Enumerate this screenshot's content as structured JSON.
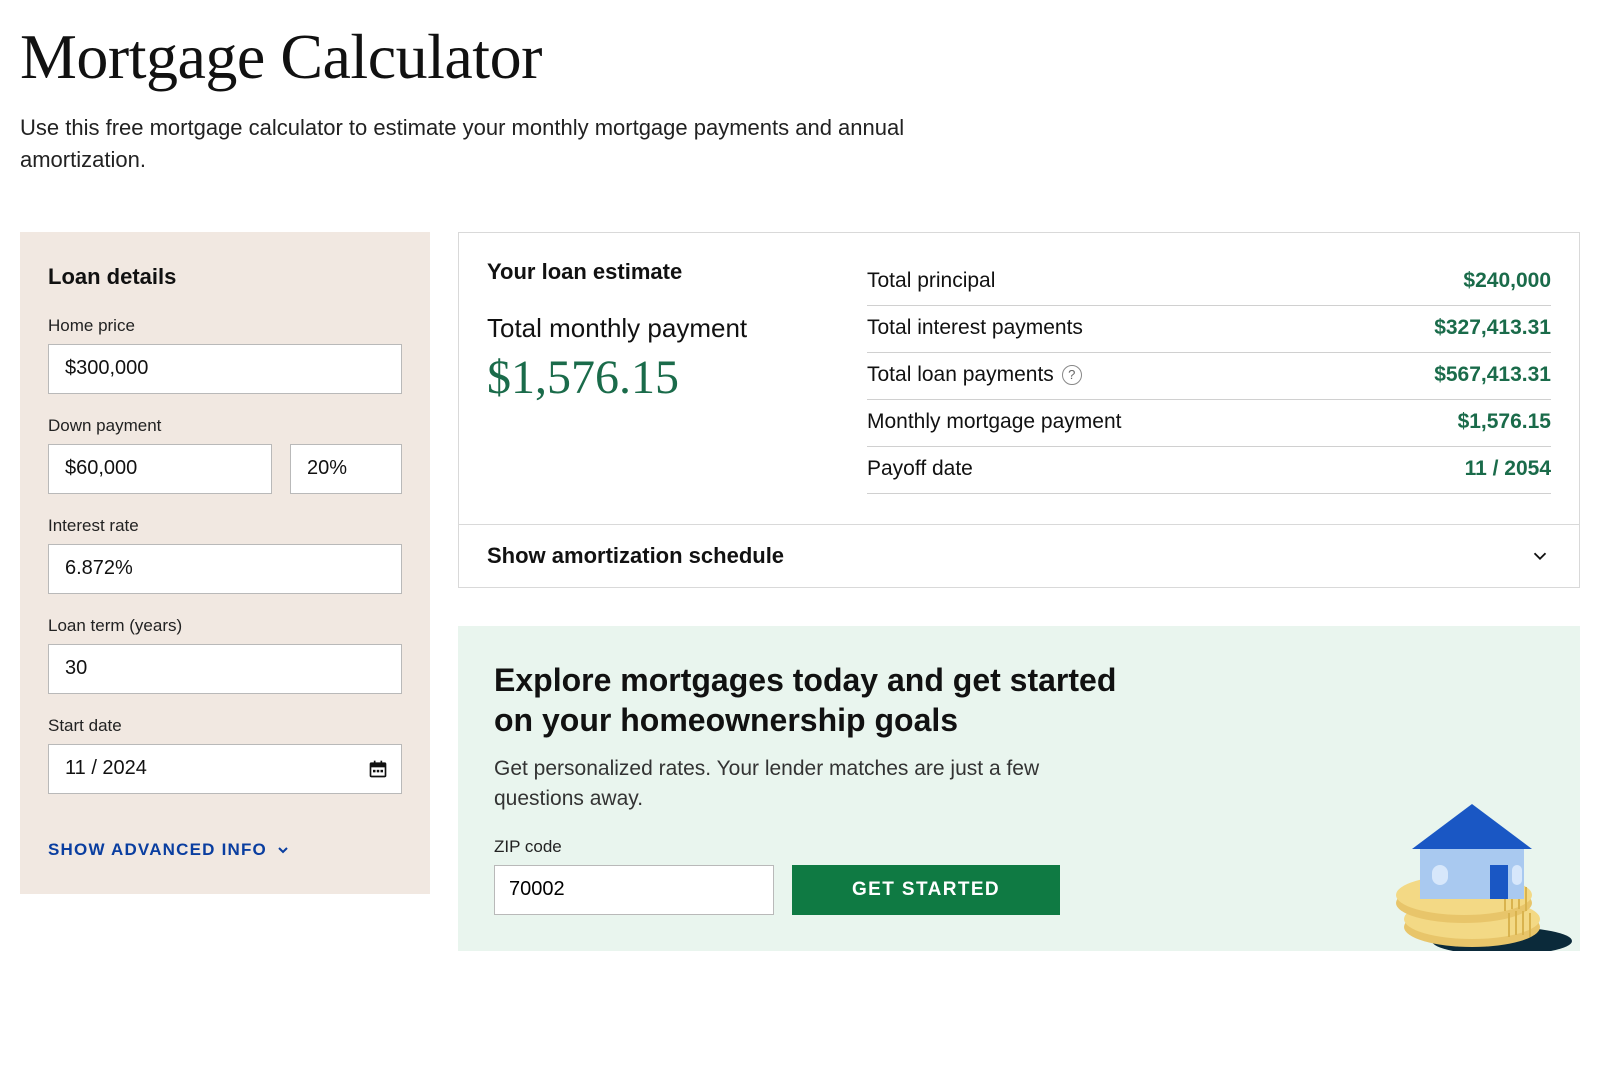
{
  "page": {
    "title": "Mortgage Calculator",
    "subtitle": "Use this free mortgage calculator to estimate your monthly mortgage payments and annual amortization."
  },
  "loan_details": {
    "heading": "Loan details",
    "home_price": {
      "label": "Home price",
      "value": "$300,000"
    },
    "down_payment": {
      "label": "Down payment",
      "amount": "$60,000",
      "percent": "20%"
    },
    "interest_rate": {
      "label": "Interest rate",
      "value": "6.872%"
    },
    "loan_term": {
      "label": "Loan term (years)",
      "value": "30"
    },
    "start_date": {
      "label": "Start date",
      "value": "11 / 2024"
    },
    "advanced_toggle": "SHOW ADVANCED INFO"
  },
  "estimate": {
    "heading": "Your loan estimate",
    "total_monthly_payment": {
      "label": "Total monthly payment",
      "value": "$1,576.15"
    },
    "rows": {
      "total_principal": {
        "label": "Total principal",
        "value": "$240,000"
      },
      "total_interest": {
        "label": "Total interest payments",
        "value": "$327,413.31"
      },
      "total_loan": {
        "label": "Total loan payments",
        "value": "$567,413.31",
        "has_help": true
      },
      "monthly_mortgage": {
        "label": "Monthly mortgage payment",
        "value": "$1,576.15"
      },
      "payoff_date": {
        "label": "Payoff date",
        "value": "11 / 2054"
      }
    },
    "amortization_toggle": "Show amortization schedule"
  },
  "cta": {
    "heading": "Explore mortgages today and get started on your homeownership goals",
    "subtext": "Get personalized rates. Your lender matches are just a few questions away.",
    "zip": {
      "label": "ZIP code",
      "value": "70002"
    },
    "button": "GET STARTED"
  }
}
